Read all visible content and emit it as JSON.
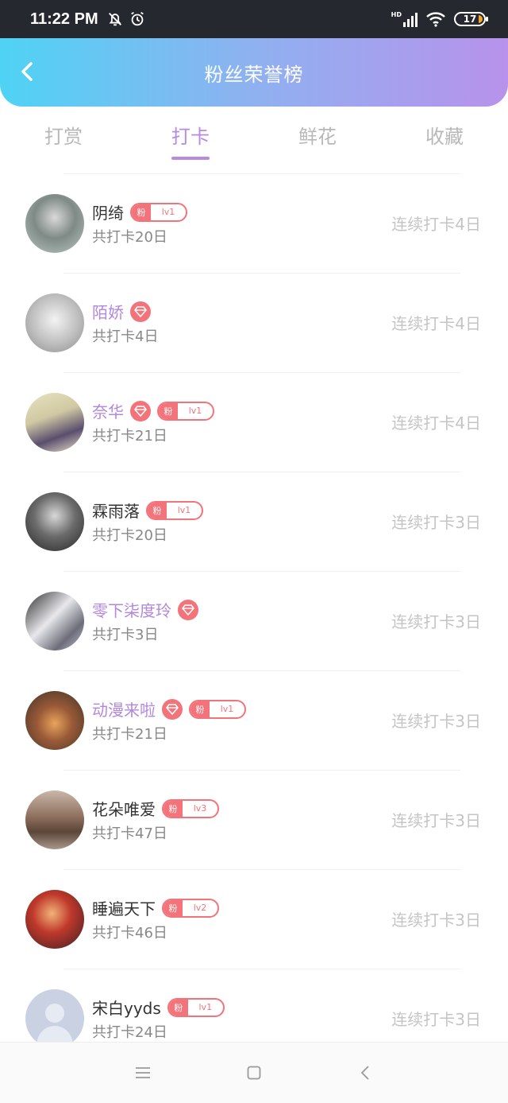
{
  "status_bar": {
    "time": "11:22 PM",
    "battery": "17",
    "network": "HD"
  },
  "header": {
    "title": "粉丝荣誉榜"
  },
  "tabs": [
    {
      "label": "打赏",
      "active": false
    },
    {
      "label": "打卡",
      "active": true
    },
    {
      "label": "鲜花",
      "active": false
    },
    {
      "label": "收藏",
      "active": false
    }
  ],
  "rows": [
    {
      "name": "阴绮",
      "vip": false,
      "fan_badge": {
        "label": "粉",
        "level": "lv1"
      },
      "total": "共打卡20日",
      "streak": "连续打卡4日"
    },
    {
      "name": "陌娇",
      "vip": true,
      "fan_badge": null,
      "total": "共打卡4日",
      "streak": "连续打卡4日"
    },
    {
      "name": "奈华",
      "vip": true,
      "fan_badge": {
        "label": "粉",
        "level": "lv1"
      },
      "total": "共打卡21日",
      "streak": "连续打卡4日"
    },
    {
      "name": "霖雨落",
      "vip": false,
      "fan_badge": {
        "label": "粉",
        "level": "lv1"
      },
      "total": "共打卡20日",
      "streak": "连续打卡3日"
    },
    {
      "name": "零下柒度玲",
      "vip": true,
      "fan_badge": null,
      "total": "共打卡3日",
      "streak": "连续打卡3日"
    },
    {
      "name": "动漫来啦",
      "vip": true,
      "fan_badge": {
        "label": "粉",
        "level": "lv1"
      },
      "total": "共打卡21日",
      "streak": "连续打卡3日"
    },
    {
      "name": "花朵唯爱",
      "vip": false,
      "fan_badge": {
        "label": "粉",
        "level": "lv3"
      },
      "total": "共打卡47日",
      "streak": "连续打卡3日"
    },
    {
      "name": "睡遍天下",
      "vip": false,
      "fan_badge": {
        "label": "粉",
        "level": "lv2"
      },
      "total": "共打卡46日",
      "streak": "连续打卡3日"
    },
    {
      "name": "宋白yyds",
      "vip": false,
      "fan_badge": {
        "label": "粉",
        "level": "lv1"
      },
      "total": "共打卡24日",
      "streak": "连续打卡3日"
    }
  ],
  "colors": {
    "accent": "#b78be0",
    "badge": "#f3737a",
    "header_start": "#4fd3f5",
    "header_end": "#b892ec"
  },
  "icons": {
    "back": "chevron-left-icon",
    "vip": "diamond-icon",
    "nav": [
      "menu-icon",
      "home-square-icon",
      "back-triangle-icon"
    ]
  }
}
